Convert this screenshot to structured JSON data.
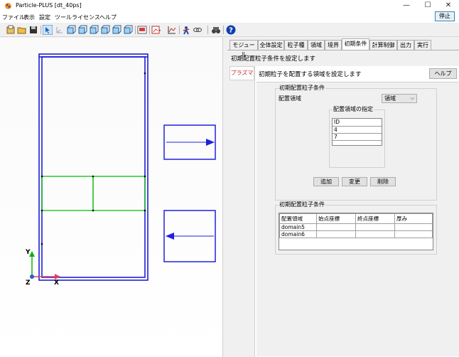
{
  "window": {
    "title": "Particle-PLUS [dt_40ps]",
    "controls": [
      "—",
      "☐",
      "✕"
    ]
  },
  "menu": {
    "items": [
      "ファイル",
      "表示",
      "設定",
      "ツール",
      "ライセンス",
      "ヘルプ"
    ],
    "stop_label": "停止"
  },
  "toolbar": {
    "buttons": [
      "new-icon",
      "open-icon",
      "save-icon",
      "select-icon",
      "axis-icon",
      "view-front-icon",
      "view-back-icon",
      "view-left-icon",
      "view-right-icon",
      "view-top-icon",
      "view-bottom-icon",
      "screenshot-icon",
      "chart-icon",
      "graph-icon",
      "run-icon",
      "link-icon",
      "binocular-icon",
      "help-icon"
    ]
  },
  "axes": {
    "y": "Y",
    "x": "X",
    "z": "Z"
  },
  "tabs": [
    "モジュール",
    "全体設定",
    "粒子種",
    "領域",
    "境界",
    "初期条件",
    "計算制御",
    "出力",
    "実行"
  ],
  "active_tab": "初期条件",
  "tab_description": "初期配置粒子条件を設定します",
  "subtab": "プラズマ",
  "subpanel": {
    "description": "初期粒子を配置する領域を設定します",
    "help_label": "ヘルプ",
    "group1": {
      "title": "初期配置粒子条件",
      "region_label": "配置領域",
      "region_value": "領域",
      "spec_group": {
        "title": "配置領域の指定",
        "list_header": "ID",
        "list_rows": [
          "4",
          "7"
        ]
      },
      "buttons": {
        "add": "追加",
        "change": "変更",
        "delete": "削除"
      }
    },
    "group2": {
      "title": "初期配置粒子条件",
      "columns": [
        "配置領域",
        "始点座標",
        "終点座標",
        "厚み"
      ],
      "rows": [
        [
          "domain5",
          "",
          "",
          ""
        ],
        [
          "domain6",
          "",
          "",
          ""
        ]
      ]
    }
  },
  "colors": {
    "region_outline": "#1010d0",
    "region_inner": "#10c010",
    "arrow_blue": "#2020e0",
    "subtab_red": "#c8262b",
    "axis_y": "#10b010",
    "axis_x": "#e04060",
    "axis_z": "#2060d0"
  }
}
